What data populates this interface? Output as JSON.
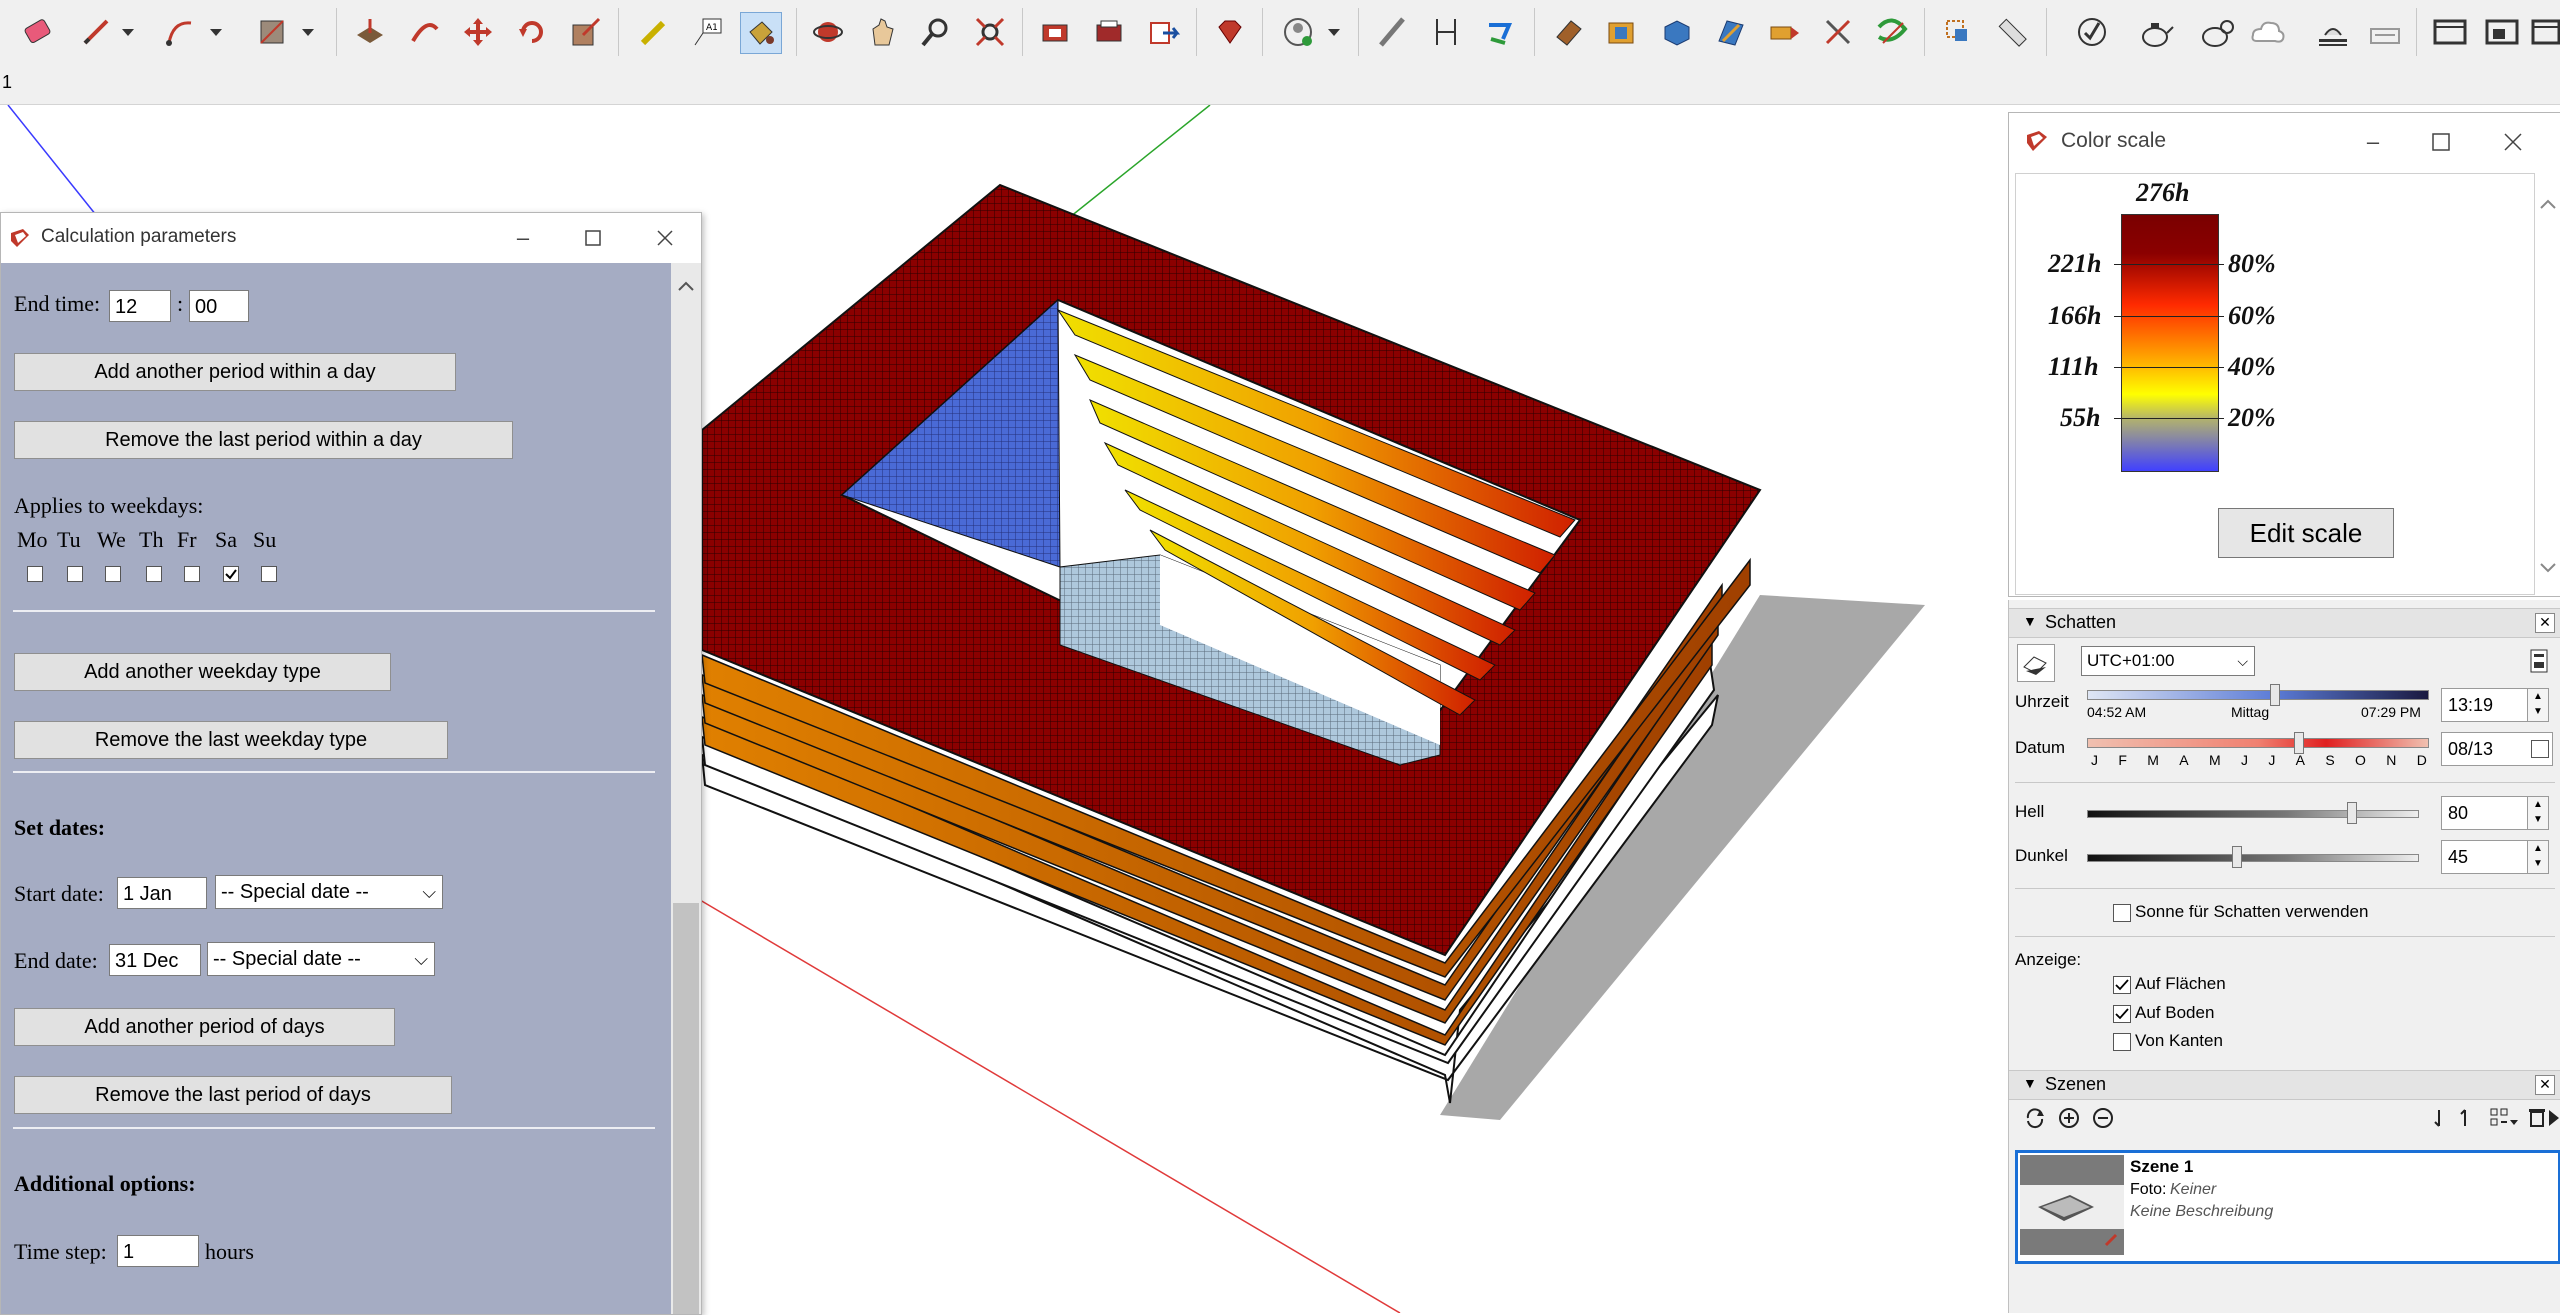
{
  "toolbar": {
    "icons": [
      "eraser-icon",
      "pencil-icon",
      "arc-icon",
      "rectangle-icon",
      "push-pull-icon",
      "follow-me-icon",
      "move-icon",
      "rotate-icon",
      "scale-icon",
      "tape-measure-icon",
      "text-icon",
      "paint-bucket-icon",
      "orbit-icon",
      "pan-icon",
      "zoom-icon",
      "zoom-extents-icon",
      "warehouse-icon",
      "extension-warehouse-icon",
      "send-to-layout-icon",
      "ruby-icon",
      "account-icon",
      "sandbox-icon",
      "dimension-icon",
      "section-icon",
      "solid-tools-icon",
      "box-icon",
      "cylinder-icon",
      "extrude-icon",
      "tape-icon",
      "cross-icon",
      "curve-icon",
      "select-icon",
      "ruler-icon",
      "check-icon",
      "teapot-icon",
      "teapot2-icon",
      "cloud-icon",
      "sun-icon",
      "cloud2-icon",
      "window-icon",
      "window2-icon",
      "window3-icon"
    ]
  },
  "tabrow": {
    "label": "1"
  },
  "calc": {
    "title": "Calculation parameters",
    "end_time_label": "End time:",
    "end_time_hour": "12",
    "time_sep": ":",
    "end_time_min": "00",
    "btn_add_period": "Add another period within a day",
    "btn_remove_period": "Remove the last period within a day",
    "applies_label": "Applies to weekdays:",
    "weekdays": [
      {
        "label": "Mo",
        "checked": false
      },
      {
        "label": "Tu",
        "checked": false
      },
      {
        "label": "We",
        "checked": false
      },
      {
        "label": "Th",
        "checked": false
      },
      {
        "label": "Fr",
        "checked": false
      },
      {
        "label": "Sa",
        "checked": true
      },
      {
        "label": "Su",
        "checked": false
      }
    ],
    "btn_add_weekday": "Add another weekday type",
    "btn_remove_weekday": "Remove the last weekday type",
    "set_dates_label": "Set dates:",
    "start_date_label": "Start date:",
    "start_date_value": "1 Jan",
    "special_date_option": "-- Special date --",
    "end_date_label": "End date:",
    "end_date_value": "31 Dec",
    "btn_add_days": "Add another period of days",
    "btn_remove_days": "Remove the last period of days",
    "additional_label": "Additional options:",
    "time_step_label": "Time step:",
    "time_step_value": "1",
    "hours_label": "hours"
  },
  "color_scale": {
    "title": "Color scale",
    "max_label": "276h",
    "left_labels": [
      "221h",
      "166h",
      "111h",
      "55h"
    ],
    "right_labels": [
      "80%",
      "60%",
      "40%",
      "20%"
    ],
    "edit_button": "Edit scale"
  },
  "shadows": {
    "header": "Schatten",
    "timezone": "UTC+01:00",
    "time_label": "Uhrzeit",
    "sunrise": "04:52 AM",
    "noon": "Mittag",
    "sunset": "07:29 PM",
    "time_value": "13:19",
    "time_fraction": 0.55,
    "date_label": "Datum",
    "months": [
      "J",
      "F",
      "M",
      "A",
      "M",
      "J",
      "J",
      "A",
      "S",
      "O",
      "N",
      "D"
    ],
    "date_value": "08/13",
    "date_fraction": 0.62,
    "light_label": "Hell",
    "light_value": "80",
    "dark_label": "Dunkel",
    "dark_value": "45",
    "sun_option": "Sonne für Schatten verwenden",
    "sun_checked": false,
    "display_label": "Anzeige:",
    "on_faces": "Auf Flächen",
    "on_faces_checked": true,
    "on_ground": "Auf Boden",
    "on_ground_checked": true,
    "from_edges": "Von Kanten",
    "from_edges_checked": false
  },
  "scenes": {
    "header": "Szenen",
    "scene_name": "Szene 1",
    "photo_label": "Foto:",
    "photo_value": "Keiner",
    "description": "Keine Beschreibung"
  },
  "colors": {
    "dialog_bg": "#a5acc3",
    "roof_red": "#8b0000",
    "selection_blue": "#1a6fd6"
  }
}
